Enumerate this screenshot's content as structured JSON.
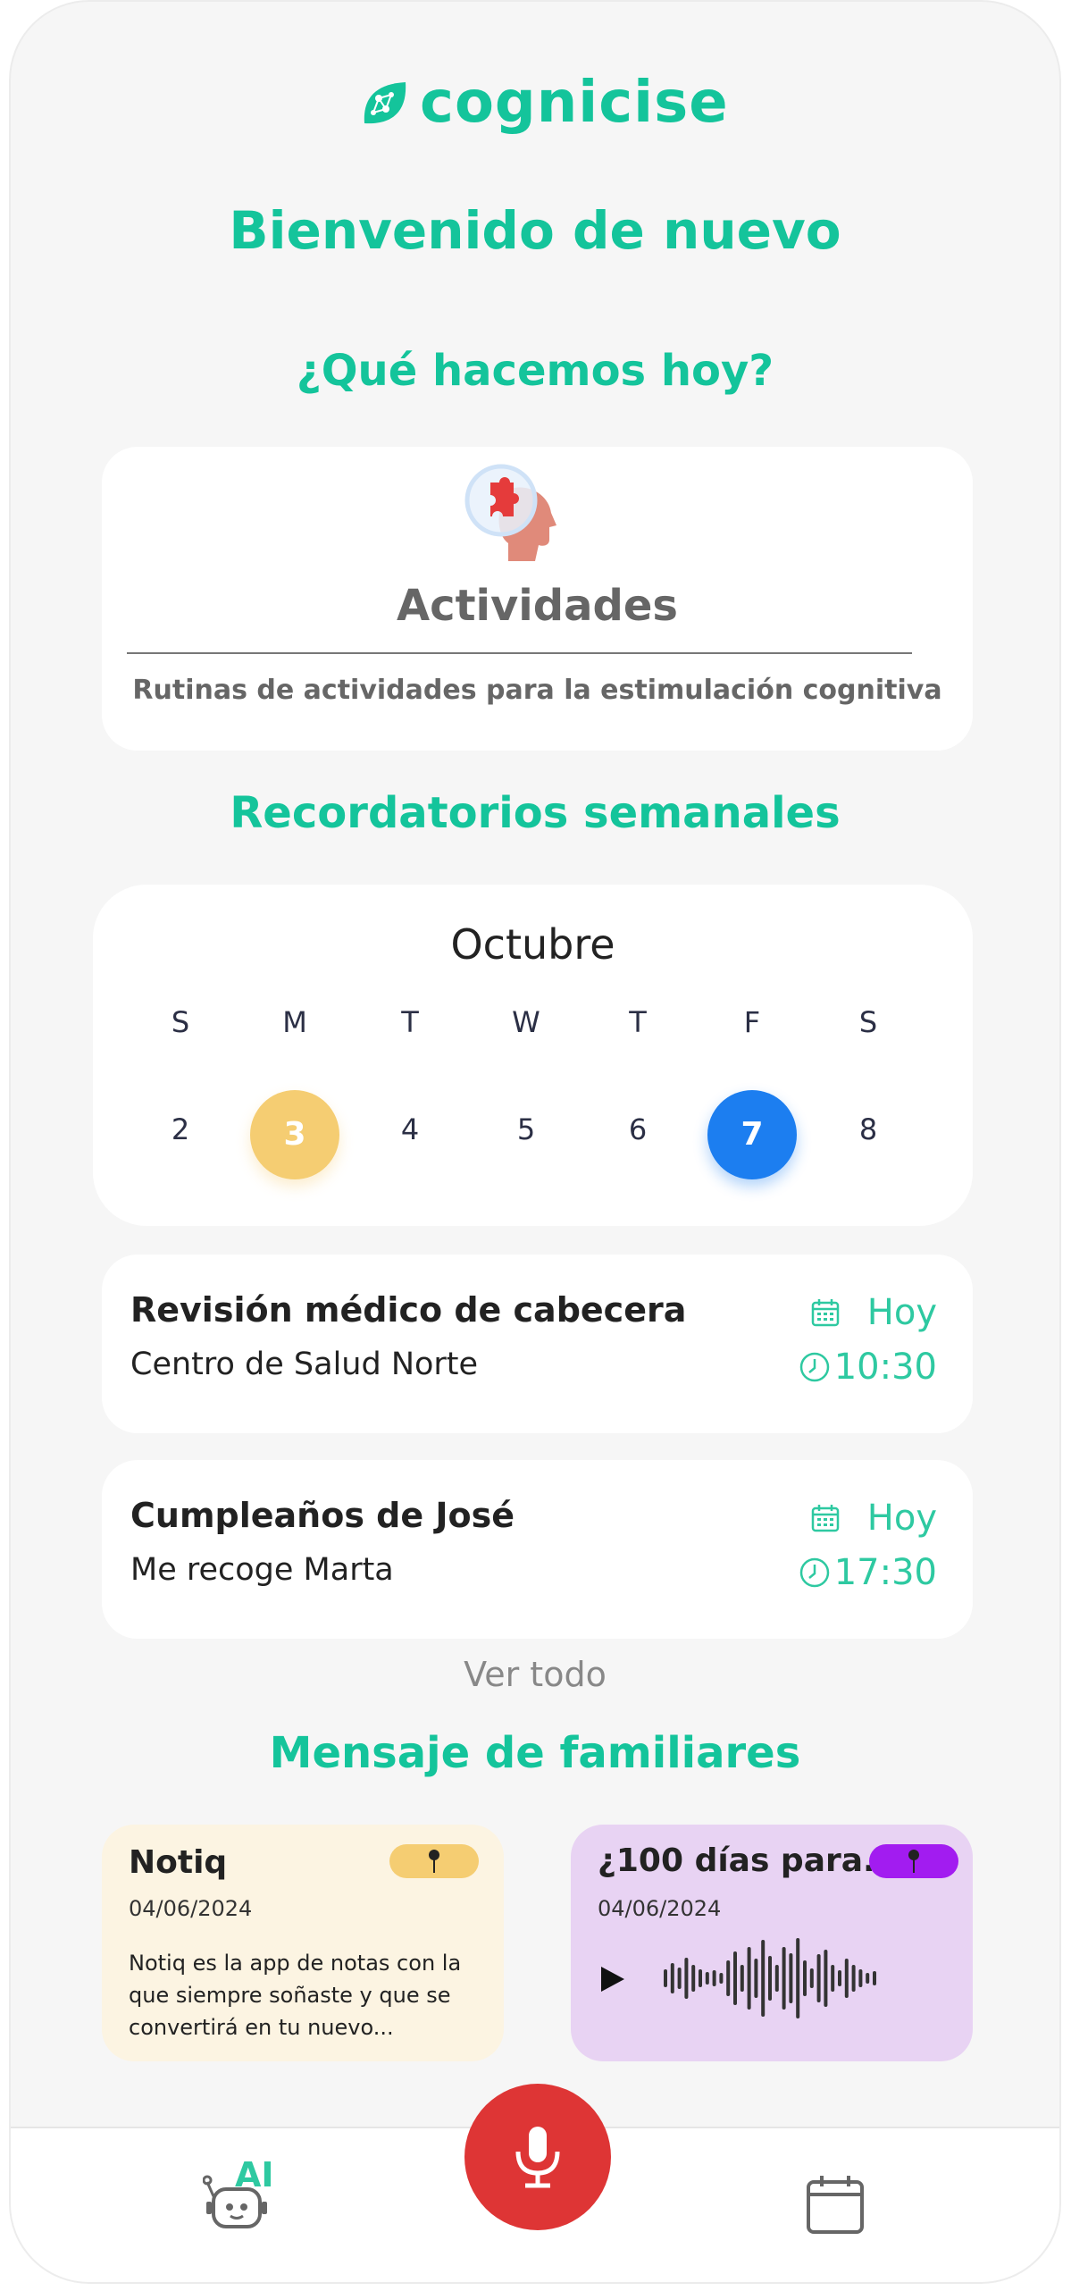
{
  "app": {
    "logo_text": "cognicise"
  },
  "welcome_title": "Bienvenido de nuevo",
  "today_heading": "¿Qué hacemos hoy?",
  "activities": {
    "title": "Actividades",
    "subtitle": "Rutinas de actividades para la estimulación cognitiva"
  },
  "reminders_heading": "Recordatorios semanales",
  "calendar": {
    "month": "Octubre",
    "weekdays": [
      "S",
      "M",
      "T",
      "W",
      "T",
      "F",
      "S"
    ],
    "dates": [
      "2",
      "3",
      "4",
      "5",
      "6",
      "7",
      "8"
    ],
    "highlighted": {
      "3": "#f5cd72",
      "7": "#1c7ef0"
    }
  },
  "reminders": [
    {
      "title": "Revisión médico de cabecera",
      "place": "Centro de Salud Norte",
      "day": "Hoy",
      "time": "10:30"
    },
    {
      "title": "Cumpleaños de José",
      "place": "Me recoge Marta",
      "day": "Hoy",
      "time": "17:30"
    }
  ],
  "see_all": "Ver todo",
  "family_heading": "Mensaje de familiares",
  "messages": [
    {
      "title": "Notiq",
      "date": "04/06/2024",
      "body": "Notiq es la app de notas con la que siempre soñaste y que se convertirá en tu nuevo...",
      "bg": "#fcf4e2",
      "pin_color": "#f5cd72"
    },
    {
      "title": "¿100 días para...",
      "date": "04/06/2024",
      "bg": "#e8d3f3",
      "pin_color": "#a21cf0"
    }
  ],
  "bottom_nav": {
    "ai_label": "AI"
  },
  "colors": {
    "accent": "#14c49b",
    "mic": "#de3535"
  }
}
